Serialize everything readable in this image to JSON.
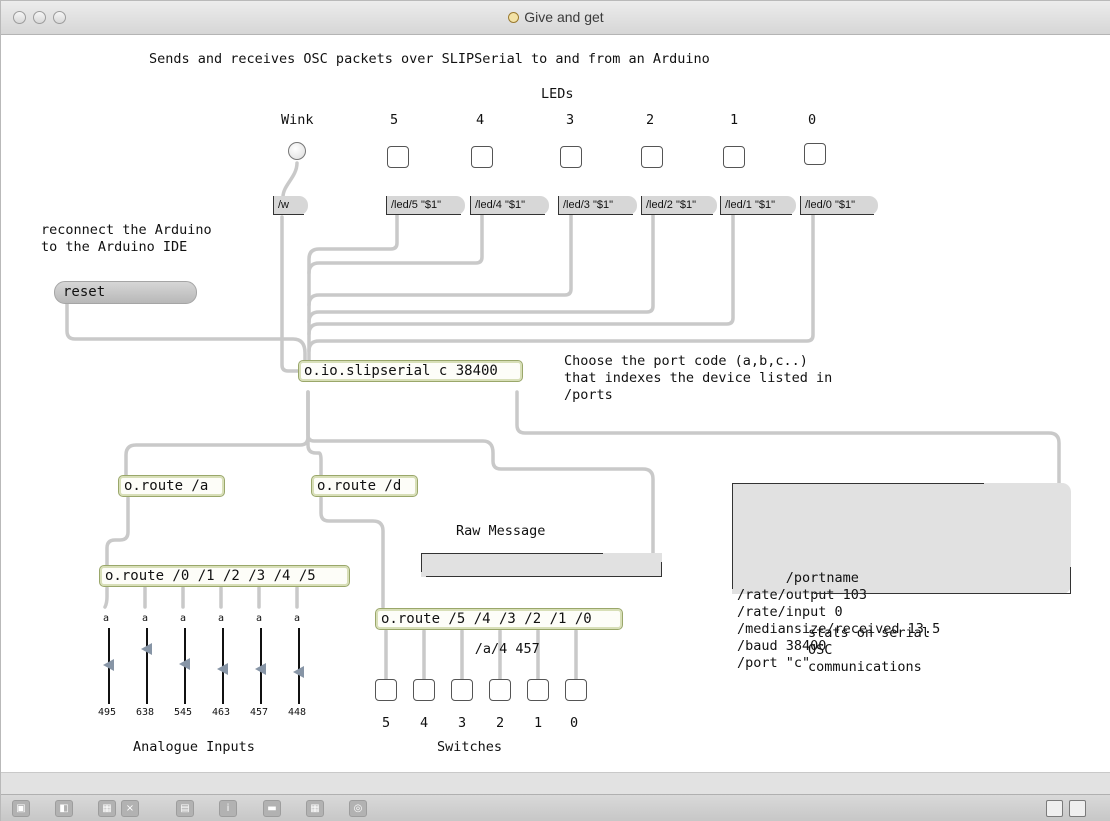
{
  "window": {
    "title": "Give and get"
  },
  "patcher": {
    "header_comment": "Sends and receives OSC packets over SLIPSerial to and from an Arduino",
    "leds_label": "LEDs",
    "wink_label": "Wink",
    "led_numbers": [
      "5",
      "4",
      "3",
      "2",
      "1",
      "0"
    ],
    "wink_message": "/w",
    "led_messages": [
      "/led/5 \"$1\"",
      "/led/4 \"$1\"",
      "/led/3 \"$1\"",
      "/led/2 \"$1\"",
      "/led/1 \"$1\"",
      "/led/0 \"$1\""
    ],
    "reconnect_comment": "reconnect the Arduino\nto the Arduino IDE",
    "reset_label": "reset",
    "slipserial_object": "o.io.slipserial c 38400",
    "port_comment": "Choose the port code (a,b,c..)\nthat indexes the device listed in\n/ports",
    "route_a": "o.route /a",
    "route_d": "o.route /d",
    "raw_message_label": "Raw Message",
    "raw_message_value": "/a/4 457",
    "route_analog": "o.route /0 /1 /2 /3 /4 /5",
    "route_switches": "o.route /5 /4 /3 /2 /1 /0",
    "analog_unpack_labels": [
      "a",
      "a",
      "a",
      "a",
      "a",
      "a"
    ],
    "analog_values": [
      "495",
      "638",
      "545",
      "463",
      "457",
      "448"
    ],
    "analog_levels": [
      0.52,
      0.76,
      0.53,
      0.46,
      0.45,
      0.41
    ],
    "analog_inputs_label": "Analogue Inputs",
    "switch_numbers": [
      "5",
      "4",
      "3",
      "2",
      "1",
      "0"
    ],
    "switches_label": "Switches",
    "stats_display": "/portname\n/rate/output 103\n/rate/input 0\n/mediansize/received 13.5\n/baud 38400\n/port \"c\"",
    "stats_comment": "stats on serial\nOSC\ncommunications"
  },
  "toolbar": {
    "icons": [
      "lock-icon",
      "presentation-icon",
      "object-palette-icon",
      "close-box-icon",
      "inspector-icon",
      "info-icon",
      "cord-icon",
      "grid-icon",
      "debug-icon"
    ],
    "right_icons": [
      "split-view-icon",
      "sidebar-icon"
    ]
  }
}
